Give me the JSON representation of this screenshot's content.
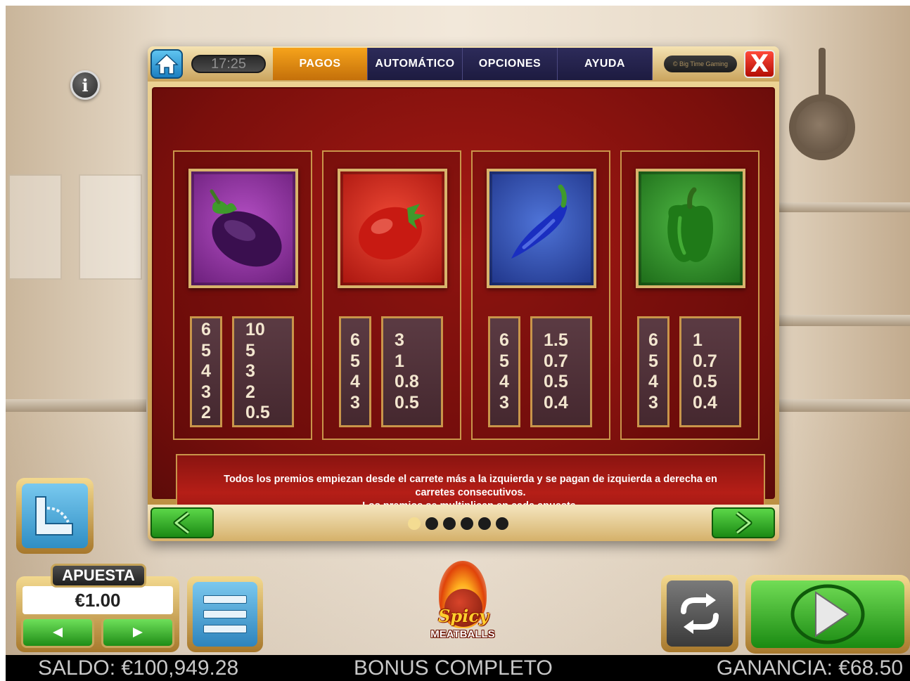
{
  "game": {
    "clock": "17:25",
    "copyright": "© Big Time Gaming",
    "close_label": "X",
    "info_label": "i"
  },
  "tabs": [
    {
      "label": "PAGOS",
      "active": true
    },
    {
      "label": "AUTOMÁTICO",
      "active": false
    },
    {
      "label": "OPCIONES",
      "active": false
    },
    {
      "label": "AYUDA",
      "active": false
    }
  ],
  "paytable": {
    "symbols": [
      {
        "name": "eggplant",
        "tile_color": "#8a2a9a",
        "counts": [
          "6",
          "5",
          "4",
          "3",
          "2"
        ],
        "pays": [
          "10",
          "5",
          "3",
          "2",
          "0.5"
        ]
      },
      {
        "name": "tomato",
        "tile_color": "#d8231a",
        "counts": [
          "6",
          "5",
          "4",
          "3"
        ],
        "pays": [
          "3",
          "1",
          "0.8",
          "0.5"
        ]
      },
      {
        "name": "blue-pepper",
        "tile_color": "#2f4fb8",
        "counts": [
          "6",
          "5",
          "4",
          "3"
        ],
        "pays": [
          "1.5",
          "0.7",
          "0.5",
          "0.4"
        ]
      },
      {
        "name": "green-pepper",
        "tile_color": "#2f8a2a",
        "counts": [
          "6",
          "5",
          "4",
          "3"
        ],
        "pays": [
          "1",
          "0.7",
          "0.5",
          "0.4"
        ]
      }
    ],
    "info_lines": [
      "Todos los premios empiezan desde el carrete más a la izquierda y se pagan de izquierda a derecha en",
      "carretes consecutivos.",
      "Los premios se multiplican en cada apuesta."
    ],
    "page_index": 1,
    "page_count": 6
  },
  "controls": {
    "bet_label": "APUESTA",
    "bet_value": "€1.00",
    "logo_line1": "Spicy",
    "logo_line2": "MEATBALLS"
  },
  "status": {
    "balance": "SALDO: €100,949.28",
    "message": "BONUS COMPLETO",
    "win": "GANANCIA: €68.50"
  }
}
